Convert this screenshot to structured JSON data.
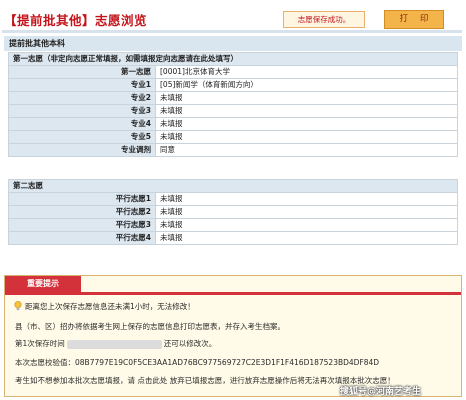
{
  "header": {
    "title": "【提前批其他】志愿浏览",
    "status": "志愿保存成功。",
    "print_label": "打印"
  },
  "section": {
    "title": "提前批其他本科"
  },
  "first_choice": {
    "caption": "第一志愿（非定向志愿正常填报，如需填报定向志愿请在此处填写）",
    "rows": [
      {
        "label": "第一志愿",
        "value": "[0001]北京体育大学"
      },
      {
        "label": "专业1",
        "value": "[05]新闻学（体育新闻方向）"
      },
      {
        "label": "专业2",
        "value": "未填报"
      },
      {
        "label": "专业3",
        "value": "未填报"
      },
      {
        "label": "专业4",
        "value": "未填报"
      },
      {
        "label": "专业5",
        "value": "未填报"
      },
      {
        "label": "专业调剂",
        "value": "同意"
      }
    ]
  },
  "second_choice": {
    "caption": "第二志愿",
    "rows": [
      {
        "label": "平行志愿1",
        "value": "未填报"
      },
      {
        "label": "平行志愿2",
        "value": "未填报"
      },
      {
        "label": "平行志愿3",
        "value": "未填报"
      },
      {
        "label": "平行志愿4",
        "value": "未填报"
      }
    ]
  },
  "notice": {
    "title": "重要提示",
    "line1": "距离您上次保存志愿信息还未满1小时，无法修改！",
    "line2": "县（市、区）招办将依据考生网上保存的志愿信息打印志愿表，并存入考生档案。",
    "line3_prefix": "第1次保存时间",
    "line3_suffix": "还可以修改次。",
    "line4": "本次志愿校验值：08B7797E19C0F5CE3AA1AD76BC977569727C2E3D1F1F416D187523BD4DF84D",
    "line5": "考生如不想参加本批次志愿填报，请 点击此处 放弃已填报志愿，进行放弃志愿操作后将无法再次填报本批次志愿！"
  },
  "watermark": "搜狐号@河南艺考生"
}
